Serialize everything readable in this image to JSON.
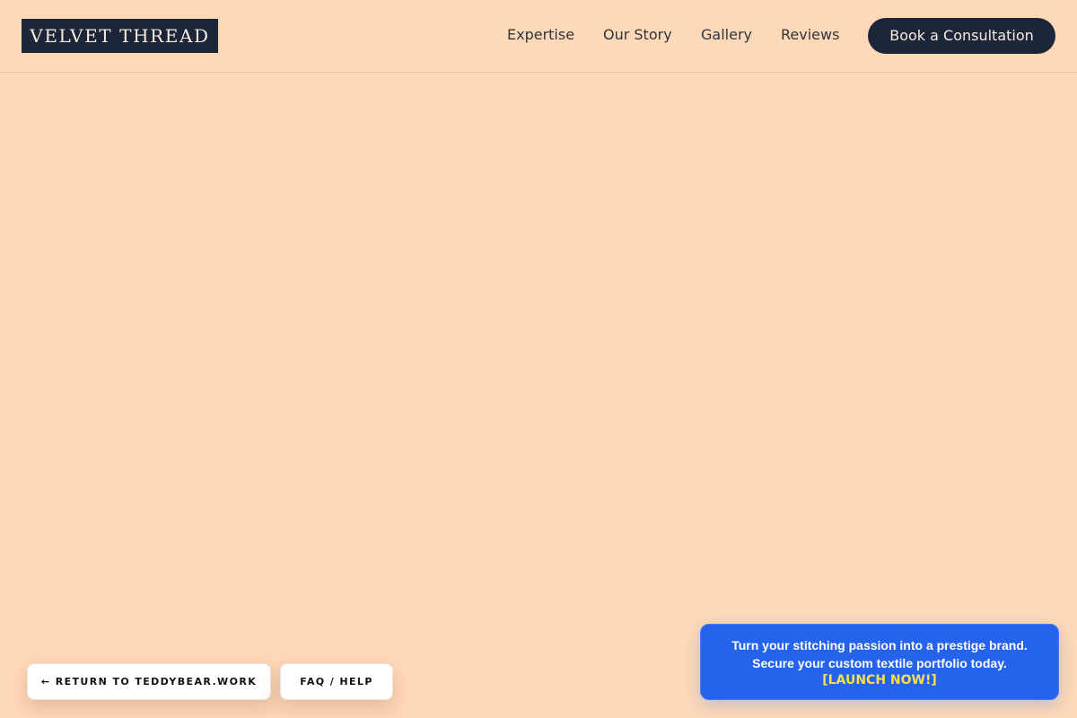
{
  "header": {
    "logo_text": "VELVET THREAD",
    "nav": [
      {
        "label": "Expertise"
      },
      {
        "label": "Our Story"
      },
      {
        "label": "Gallery"
      },
      {
        "label": "Reviews"
      }
    ],
    "cta_label": "Book a Consultation"
  },
  "footer_pills": {
    "return_label": "← RETURN TO TEDDYBEAR.WORK",
    "faq_label": "FAQ / HELP"
  },
  "promo": {
    "line1": "Turn your stitching passion into a prestige brand.",
    "line2": "Secure your custom textile portfolio today.",
    "cta": "[LAUNCH NOW!]"
  },
  "colors": {
    "page_background": "#fed9b8",
    "brand_dark": "#1c2638",
    "promo_blue": "#2563eb",
    "promo_accent": "#fde047"
  }
}
